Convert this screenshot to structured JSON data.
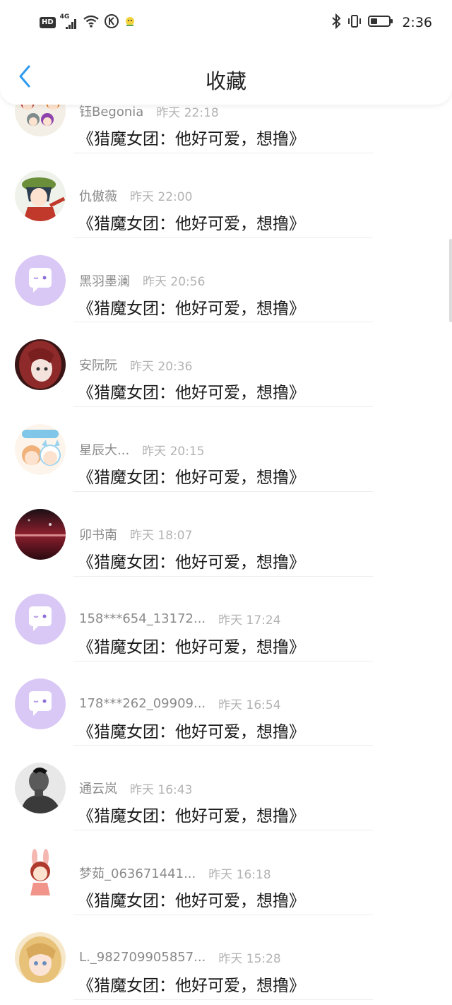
{
  "status_bar": {
    "hd_label": "HD",
    "network_label": "4G",
    "time": "2:36"
  },
  "header": {
    "title": "收藏",
    "back_icon": "chevron-left-icon"
  },
  "accent_color": "#2f9bf0",
  "default_avatar_color": "#d9c8f5",
  "items": [
    {
      "user": "钰Begonia",
      "time": "昨天 22:18",
      "title": "《猎魔女团：他好可爱，想撸》",
      "avatar": "chibi-group-avatar"
    },
    {
      "user": "仇傲薇",
      "time": "昨天 22:00",
      "title": "《猎魔女团：他好可爱，想撸》",
      "avatar": "anime-boy-avatar"
    },
    {
      "user": "黑羽墨澜",
      "time": "昨天 20:56",
      "title": "《猎魔女团：他好可爱，想撸》",
      "avatar": "default-chat-avatar"
    },
    {
      "user": "安阮阮",
      "time": "昨天 20:36",
      "title": "《猎魔女团：他好可爱，想撸》",
      "avatar": "red-hair-girl-avatar"
    },
    {
      "user": "星辰大...",
      "time": "昨天 20:15",
      "title": "《猎魔女团：他好可爱，想撸》",
      "avatar": "cartoon-kids-avatar"
    },
    {
      "user": "卯书南",
      "time": "昨天 18:07",
      "title": "《猎魔女团：他好可爱，想撸》",
      "avatar": "night-scene-avatar"
    },
    {
      "user": "158***654_13172...",
      "time": "昨天 17:24",
      "title": "《猎魔女团：他好可爱，想撸》",
      "avatar": "default-chat-avatar"
    },
    {
      "user": "178***262_09909...",
      "time": "昨天 16:54",
      "title": "《猎魔女团：他好可爱，想撸》",
      "avatar": "default-chat-avatar"
    },
    {
      "user": "通云岚",
      "time": "昨天 16:43",
      "title": "《猎魔女团：他好可爱，想撸》",
      "avatar": "bw-photo-avatar"
    },
    {
      "user": "梦茹_063671441...",
      "time": "昨天 16:18",
      "title": "《猎魔女团：他好可爱，想撸》",
      "avatar": "bunny-girl-avatar"
    },
    {
      "user": "L._982709905857...",
      "time": "昨天 15:28",
      "title": "《猎魔女团：他好可爱，想撸》",
      "avatar": "blonde-girl-avatar"
    }
  ]
}
